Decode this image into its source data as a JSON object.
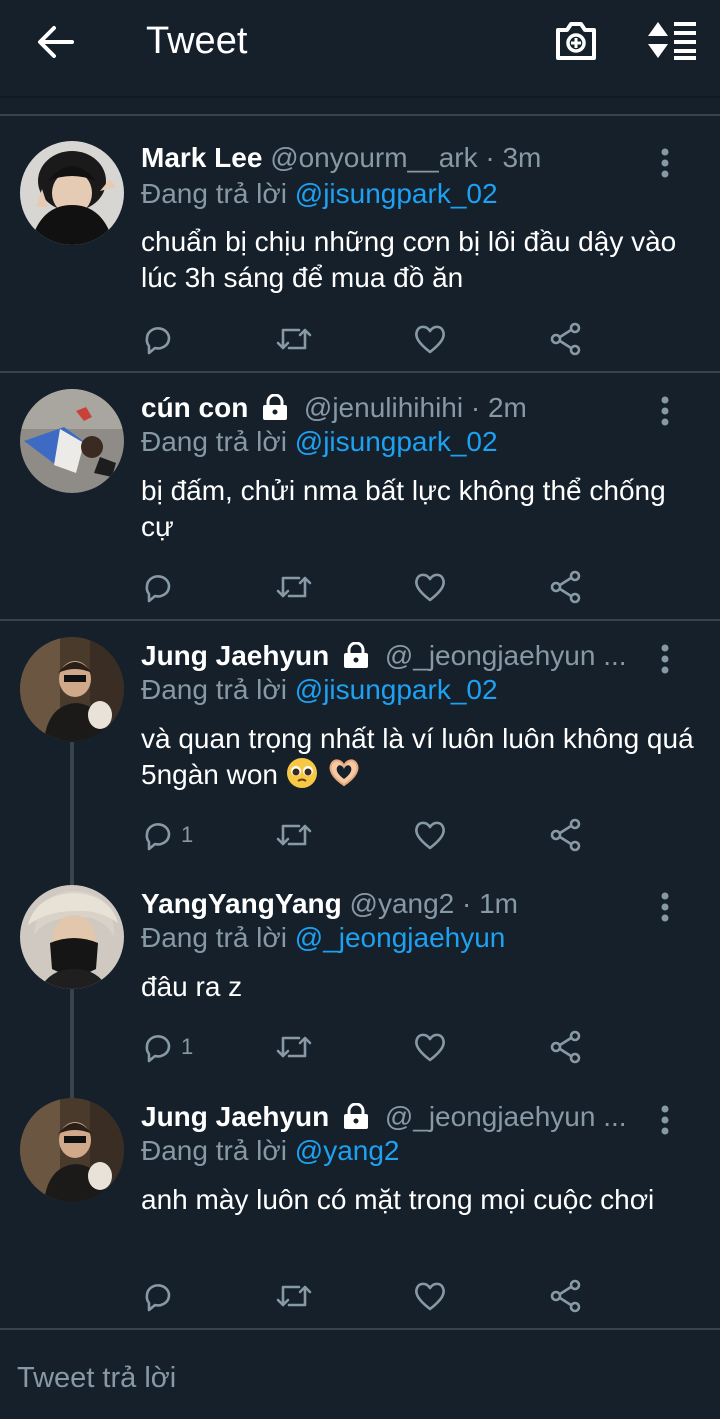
{
  "header": {
    "title": "Tweet",
    "icons": [
      "back-arrow-icon",
      "camera-add-icon",
      "sort-icon"
    ]
  },
  "reply_prefix": "Đang trả lời",
  "tweets": [
    {
      "name": "Mark Lee",
      "locked": false,
      "handle": "@onyourm__ark · 3m",
      "replying_to": "@jisungpark_02",
      "text": "chuẩn bị chịu những cơn bị lôi đầu dậy vào lúc 3h sáng để mua đồ ăn",
      "reply_count": ""
    },
    {
      "name": "cún con",
      "locked": true,
      "handle": "@jenulihihihi · 2m",
      "replying_to": "@jisungpark_02",
      "text": "bị đấm, chửi nma bất lực không thể chống cự",
      "reply_count": ""
    },
    {
      "name": "Jung Jaehyun",
      "locked": true,
      "handle": "@_jeongjaehyun ...",
      "replying_to": "@jisungpark_02",
      "text": "và quan trọng nhất là ví luôn luôn không quá 5ngàn won",
      "reply_count": "1"
    },
    {
      "name": "YangYangYang",
      "locked": false,
      "handle": "@yang2 · 1m",
      "replying_to": "@_jeongjaehyun",
      "text": "đâu ra z",
      "reply_count": "1"
    },
    {
      "name": "Jung Jaehyun",
      "locked": true,
      "handle": "@_jeongjaehyun ...",
      "replying_to": "@yang2",
      "text": "anh mày luôn có mặt trong mọi cuộc chơi",
      "reply_count": ""
    }
  ],
  "compose": {
    "placeholder": "Tweet trả lời"
  },
  "colors": {
    "background": "#15202b",
    "secondary_text": "#8899a6",
    "link": "#1da1f2",
    "divider": "#38444d"
  }
}
